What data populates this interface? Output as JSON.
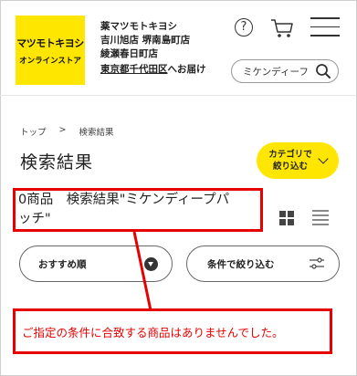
{
  "header": {
    "logo_line1": "マツモトキヨシ",
    "logo_line2": "オンラインストア",
    "store_lines": [
      "薬マツモトキヨシ",
      "吉川旭店 堺南島町店",
      "綾瀬春日町店"
    ],
    "delivery_area": "東京都千代田区",
    "delivery_suffix": "へお届け",
    "help_label": "?",
    "search_value": "ミケンディーフ"
  },
  "breadcrumb": {
    "home": "トップ",
    "separator": ">",
    "current": "検索結果"
  },
  "page_title": "検索結果",
  "category_button": {
    "line1": "カテゴリで",
    "line2": "絞り込む"
  },
  "result": {
    "line1": "0商品　検索結果\"ミケンディープパ",
    "line2": "ッチ\""
  },
  "sort_button": {
    "label": "おすすめ順"
  },
  "filter_button": {
    "label": "条件で絞り込む"
  },
  "no_results_message": "ご指定の条件に合致する商品はありませんでした。",
  "colors": {
    "brand_yellow": "#ffe600",
    "highlight_red": "#e60000"
  }
}
